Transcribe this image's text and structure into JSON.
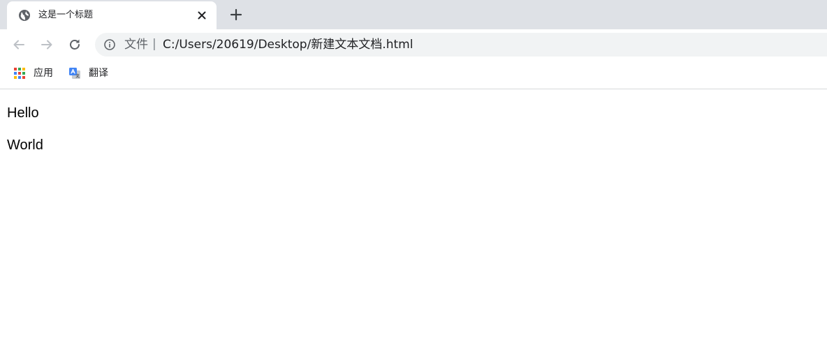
{
  "tab": {
    "title": "这是一个标题",
    "favicon": "globe-icon",
    "close": "close-icon"
  },
  "new_tab": "plus-icon",
  "toolbar": {
    "back": "arrow-left-icon",
    "forward": "arrow-right-icon",
    "reload": "reload-icon",
    "scheme_label": "文件",
    "scheme_separator": "|",
    "url": "C:/Users/20619/Desktop/新建文本文档.html"
  },
  "bookmarks": [
    {
      "label": "应用",
      "icon": "apps-grid-icon"
    },
    {
      "label": "翻译",
      "icon": "translate-icon"
    }
  ],
  "content": {
    "paragraphs": [
      "Hello",
      "World"
    ]
  },
  "colors": {
    "tabstrip": "#dee1e6",
    "omnibox": "#f1f3f4",
    "text": "#202124",
    "icon": "#5f6368"
  }
}
